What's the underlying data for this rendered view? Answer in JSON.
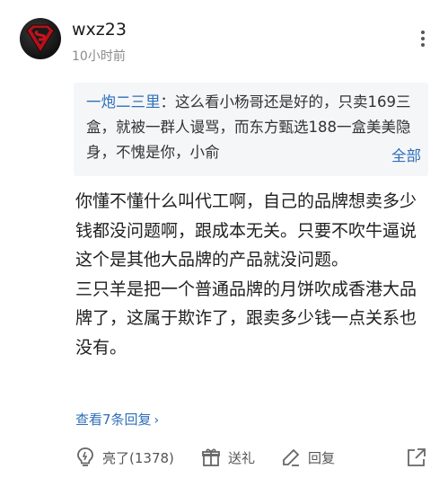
{
  "comment": {
    "username": "wxz23",
    "time": "10小时前",
    "quote": {
      "author": "一炮二三里",
      "separator": "：",
      "text": "这么看小杨哥还是好的，只卖169三盒，就被一群人谩骂，而东方甄选188一盒美美隐身，不愧是你，小俞",
      "expand_label": "全部"
    },
    "body_lines": [
      "你懂不懂什么叫代工啊，自己的品牌想卖多少钱都没问题啊，跟成本无关。只要不吹牛逼说这个是其他大品牌的产品就没问题。",
      "三只羊是把一个普通品牌的月饼吹成香港大品牌了，这属于欺诈了，跟卖多少钱一点关系也没有。"
    ],
    "replies_label": "查看7条回复",
    "replies_chevron": "›"
  },
  "actions": {
    "like_label": "亮了(1378)",
    "gift_label": "送礼",
    "reply_label": "回复"
  },
  "icons": {
    "avatar": "superman-logo-avatar",
    "more": "more-vertical-icon",
    "like": "bulb-icon",
    "gift": "gift-icon",
    "reply": "edit-icon",
    "share": "share-icon"
  },
  "colors": {
    "link": "#2f6fb8",
    "quote_background": "#f5f6f8",
    "muted": "#8a8a8a"
  }
}
